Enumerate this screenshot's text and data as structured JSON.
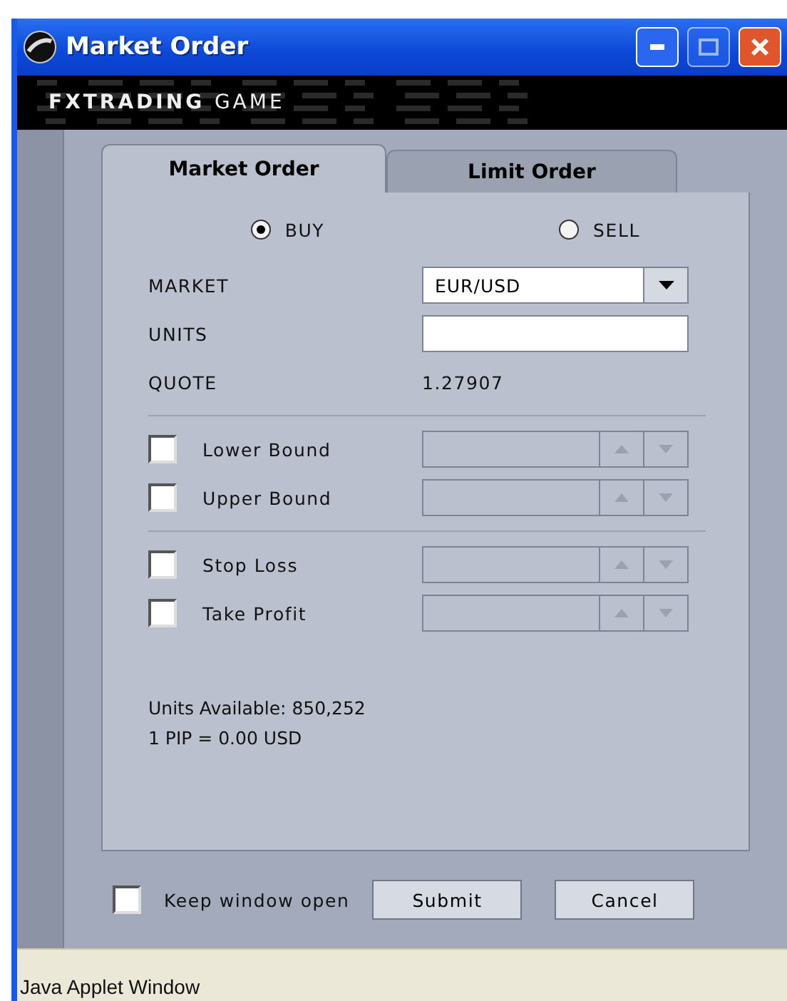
{
  "window": {
    "title": "Market Order"
  },
  "banner": {
    "brand_first": "FXTRADING",
    "brand_second": "GAME"
  },
  "tabs": [
    {
      "label": "Market Order",
      "selected": true
    },
    {
      "label": "Limit Order",
      "selected": false
    }
  ],
  "side": [
    {
      "label": "BUY",
      "selected": true
    },
    {
      "label": "SELL",
      "selected": false
    }
  ],
  "fields": [
    {
      "kind": "dropdown",
      "label": "MARKET",
      "value": "EUR/USD"
    },
    {
      "kind": "input",
      "label": "UNITS"
    },
    {
      "kind": "text",
      "label": "QUOTE",
      "value": "1.27907"
    }
  ],
  "bounds": [
    {
      "label": "Lower Bound",
      "checked": false
    },
    {
      "label": "Upper Bound",
      "checked": false
    }
  ],
  "exits": [
    {
      "label": "Stop Loss",
      "checked": false
    },
    {
      "label": "Take Profit",
      "checked": false
    }
  ],
  "info": [
    "Units Available: 850,252",
    "1 PIP = 0.00 USD"
  ],
  "keep_open": {
    "label": "Keep window open",
    "checked": false
  },
  "buttons": [
    "Submit",
    "Cancel"
  ],
  "status_bar": "Java Applet Window"
}
